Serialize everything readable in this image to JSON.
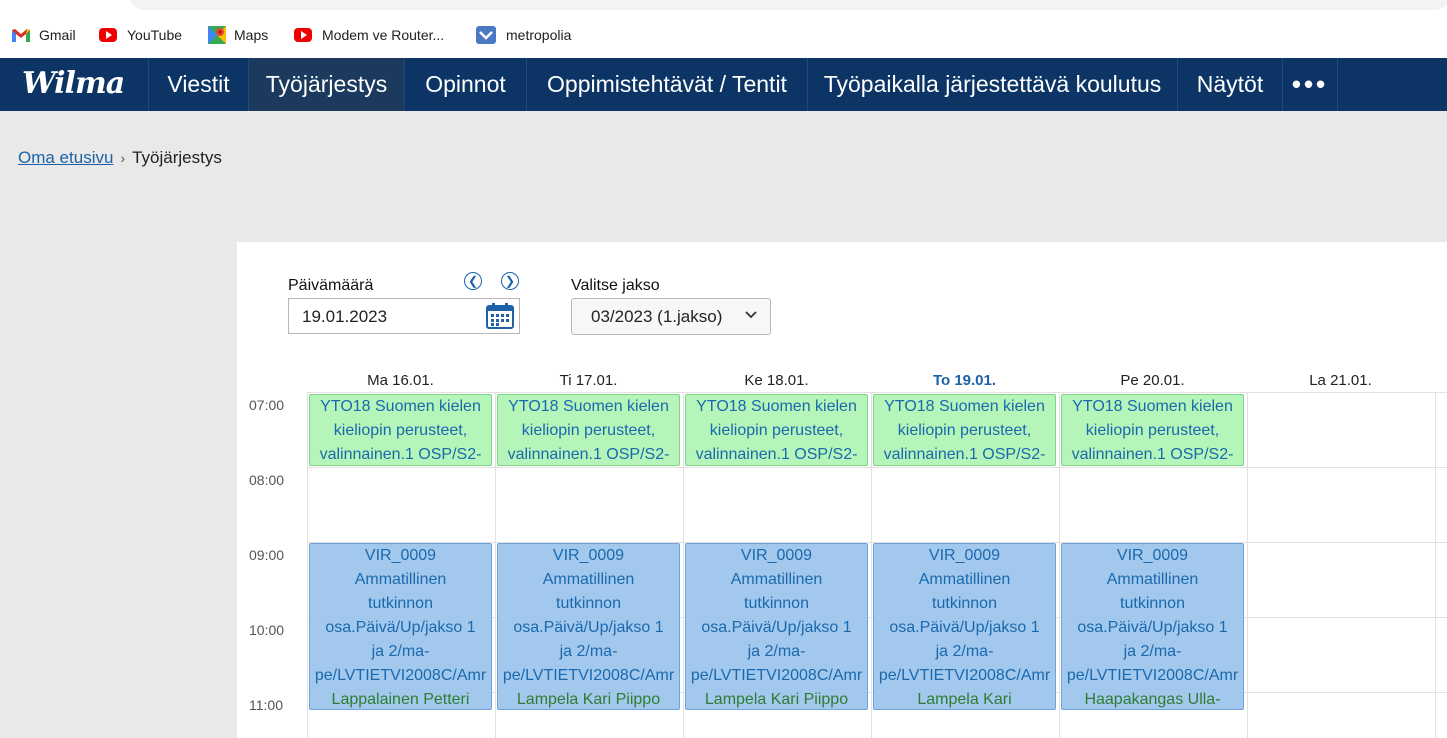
{
  "bookmarks": [
    {
      "label": "Gmail",
      "icon": "gmail-icon"
    },
    {
      "label": "YouTube",
      "icon": "youtube-icon"
    },
    {
      "label": "Maps",
      "icon": "maps-icon"
    },
    {
      "label": "Modem ve Router...",
      "icon": "youtube-icon"
    },
    {
      "label": "metropolia",
      "icon": "metropolia-icon"
    }
  ],
  "nav": {
    "logo": "Wilma",
    "items": [
      {
        "label": "Viestit"
      },
      {
        "label": "Työjärjestys"
      },
      {
        "label": "Opinnot"
      },
      {
        "label": "Oppimistehtävät / Tentit"
      },
      {
        "label": "Työpaikalla järjestettävä koulutus"
      },
      {
        "label": "Näytöt"
      }
    ],
    "more_label": "•••",
    "active": "Työjärjestys"
  },
  "breadcrumb": {
    "home": "Oma etusivu",
    "separator": "›",
    "current": "Työjärjestys"
  },
  "date_picker": {
    "label": "Päivämäärä",
    "value": "19.01.2023",
    "prev_icon": "chevron-left-icon",
    "next_icon": "chevron-right-icon",
    "calendar_icon": "calendar-icon"
  },
  "period_select": {
    "label": "Valitse jakso",
    "value": "03/2023 (1.jakso)"
  },
  "schedule": {
    "days": [
      {
        "label": "Ma 16.01.",
        "today": false
      },
      {
        "label": "Ti 17.01.",
        "today": false
      },
      {
        "label": "Ke 18.01.",
        "today": false
      },
      {
        "label": "To 19.01.",
        "today": true
      },
      {
        "label": "Pe 20.01.",
        "today": false
      },
      {
        "label": "La 21.01.",
        "today": false
      }
    ],
    "times": [
      "07:00",
      "08:00",
      "09:00",
      "10:00",
      "11:00"
    ],
    "morning_events": [
      {
        "lines": [
          "YTO18 Suomen kielen",
          "kieliopin perusteet,",
          "valinnainen.1 OSP/S2-"
        ]
      },
      {
        "lines": [
          "YTO18 Suomen kielen",
          "kieliopin perusteet,",
          "valinnainen.1 OSP/S2-"
        ]
      },
      {
        "lines": [
          "YTO18 Suomen kielen",
          "kieliopin perusteet,",
          "valinnainen.1 OSP/S2-"
        ]
      },
      {
        "lines": [
          "YTO18 Suomen kielen",
          "kieliopin perusteet,",
          "valinnainen.1 OSP/S2-"
        ]
      },
      {
        "lines": [
          "YTO18 Suomen kielen",
          "kieliopin perusteet,",
          "valinnainen.1 OSP/S2-"
        ]
      }
    ],
    "main_events": [
      {
        "lines": [
          "VIR_0009",
          "Ammatillinen",
          "tutkinnon",
          "osa.Päivä/Up/jakso 1",
          "ja 2/ma-",
          "pe/LVTIETVI2008C/Amr"
        ],
        "teacher": "Lappalainen Petteri"
      },
      {
        "lines": [
          "VIR_0009",
          "Ammatillinen",
          "tutkinnon",
          "osa.Päivä/Up/jakso 1",
          "ja 2/ma-",
          "pe/LVTIETVI2008C/Amr"
        ],
        "teacher": "Lampela Kari Piippo"
      },
      {
        "lines": [
          "VIR_0009",
          "Ammatillinen",
          "tutkinnon",
          "osa.Päivä/Up/jakso 1",
          "ja 2/ma-",
          "pe/LVTIETVI2008C/Amr"
        ],
        "teacher": "Lampela Kari Piippo"
      },
      {
        "lines": [
          "VIR_0009",
          "Ammatillinen",
          "tutkinnon",
          "osa.Päivä/Up/jakso 1",
          "ja 2/ma-",
          "pe/LVTIETVI2008C/Amr"
        ],
        "teacher": "Lampela Kari"
      },
      {
        "lines": [
          "VIR_0009",
          "Ammatillinen",
          "tutkinnon",
          "osa.Päivä/Up/jakso 1",
          "ja 2/ma-",
          "pe/LVTIETVI2008C/Amr"
        ],
        "teacher": "Haapakangas Ulla-"
      }
    ]
  },
  "colors": {
    "nav_bg": "#0c3565",
    "nav_active_bg": "#1b3a5e",
    "link": "#1d62a8",
    "event_green": "#b5f5b9",
    "event_blue": "#a3c8ee",
    "teacher_text": "#2e7d32"
  }
}
